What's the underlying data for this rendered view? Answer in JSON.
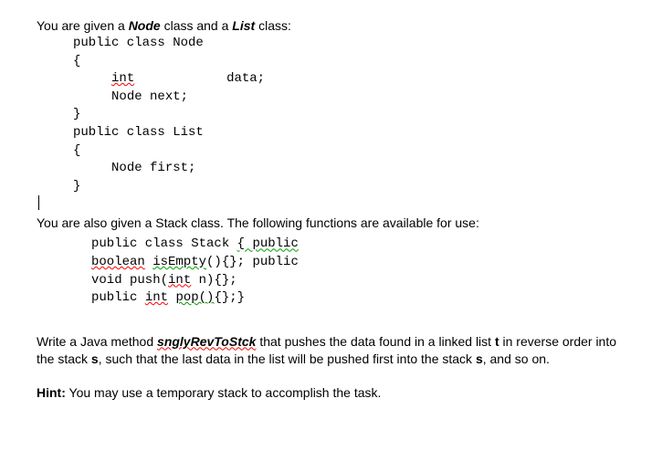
{
  "intro": {
    "prefix": "You are given a ",
    "node_class": "Node",
    "mid": " class and a ",
    "list_class": "List",
    "suffix": " class:"
  },
  "code1": {
    "line1": "public class Node",
    "line2": "{",
    "line3_int": "int",
    "line3_data": "data;",
    "line4": "Node next;",
    "line5": "}",
    "line6": "public class List",
    "line7": "{",
    "line8": "Node first;",
    "line9": "}"
  },
  "mid": {
    "text": "You are also given a Stack class. The following functions are available for use:"
  },
  "code2": {
    "l1a": "public class Stack ",
    "l1b": "{ public",
    "l2a": "boolean",
    "l2b": " ",
    "l2c": "isEmpty",
    "l2d": "(){}; public",
    "l3a": "void push(",
    "l3b": "int",
    "l3c": " n){};",
    "l4a": "public ",
    "l4b": "int",
    "l4c": " ",
    "l4d": "pop()",
    "l4e": "{};}"
  },
  "task": {
    "prefix": "Write a Java method ",
    "method": "snglyRevToStck",
    "body1": " that pushes the data found in a linked list ",
    "t": "t",
    "body2": " in reverse order into the stack ",
    "s": "s",
    "body3": ", such that the last data in the list will be pushed first into the stack ",
    "s2": "s",
    "body4": ", and so on."
  },
  "hint": {
    "label": "Hint:",
    "text": " You may use a temporary stack to accomplish the task."
  }
}
